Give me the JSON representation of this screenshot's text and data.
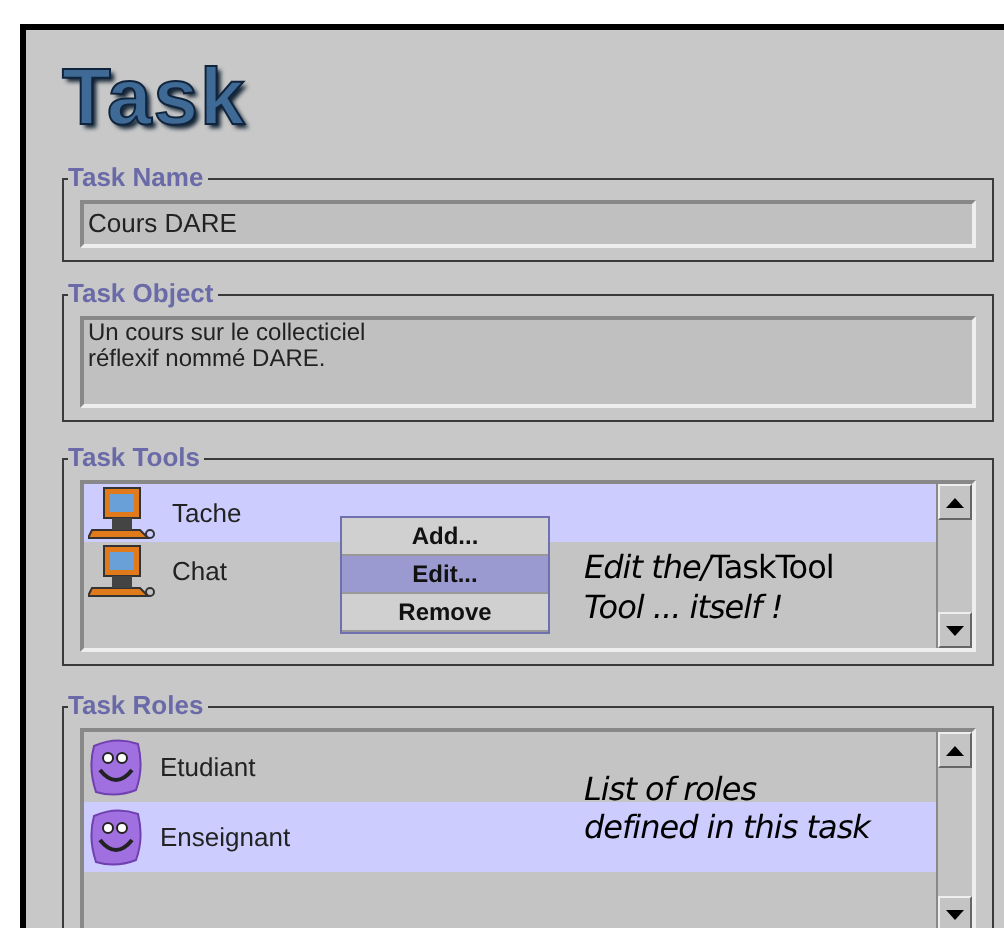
{
  "logo": "Task",
  "task_name": {
    "legend": "Task Name",
    "value": "Cours DARE"
  },
  "task_object": {
    "legend": "Task Object",
    "value": "Un cours sur le collecticiel\nréflexif nommé DARE."
  },
  "task_tools": {
    "legend": "Task Tools",
    "items": [
      {
        "label": "Tache",
        "selected": true
      },
      {
        "label": "Chat",
        "selected": false
      }
    ],
    "context_menu": [
      {
        "label": "Add...",
        "selected": false
      },
      {
        "label": "Edit...",
        "selected": true
      },
      {
        "label": "Remove",
        "selected": false
      }
    ],
    "annotation": {
      "italic_start": "Edit the/",
      "plain_end": "TaskTool",
      "second_line": "Tool ... itself !"
    }
  },
  "task_roles": {
    "legend": "Task Roles",
    "items": [
      {
        "label": "Etudiant",
        "selected": false
      },
      {
        "label": "Enseignant",
        "selected": true
      }
    ],
    "annotation": "List of roles\ndefined in this task"
  }
}
